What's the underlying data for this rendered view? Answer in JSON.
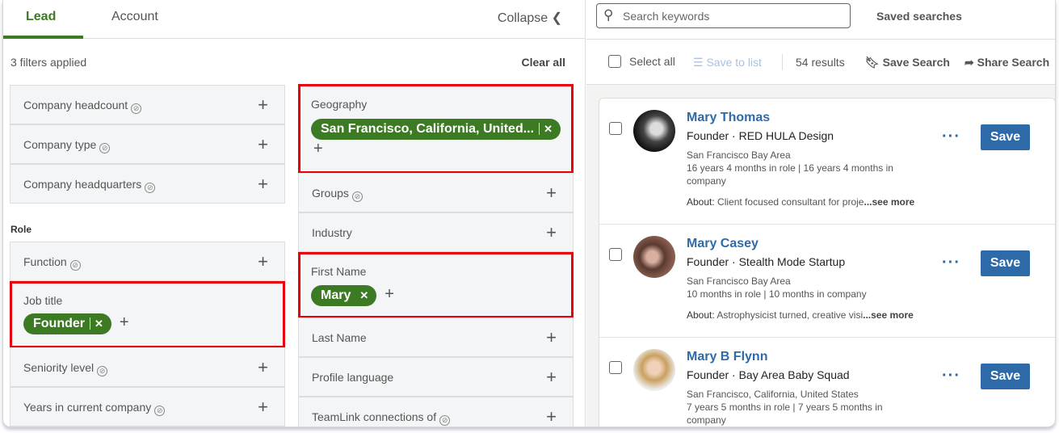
{
  "tabs": {
    "lead": "Lead",
    "account": "Account",
    "collapse": "Collapse ❮"
  },
  "filters_applied": "3 filters applied",
  "clear_all": "Clear all",
  "role_label": "Role",
  "left_filters": [
    "Company headcount",
    "Company type",
    "Company headquarters",
    "Function",
    "Job title",
    "Seniority level",
    "Years in current company"
  ],
  "job_title_value": "Founder",
  "right_filters": [
    "Geography",
    "Groups",
    "Industry",
    "First Name",
    "Last Name",
    "Profile language",
    "TeamLink connections of"
  ],
  "geography_value": "San Francisco, California, United...",
  "first_name_value": "Mary",
  "search": {
    "placeholder": "Search keywords",
    "saved": "Saved searches"
  },
  "toolbar": {
    "select_all": "Select all",
    "save_to_list": "Save to list",
    "results": "54 results",
    "save_search": "Save Search",
    "share_search": "Share Search"
  },
  "leads": [
    {
      "name": "Mary Thomas",
      "title": "Founder · RED HULA Design",
      "location": "San Francisco Bay Area",
      "tenure": "16 years 4 months in role | 16 years 4 months in company",
      "about_label": "About:",
      "about": "Client focused consultant for proje",
      "see_more": "...see more",
      "save": "Save"
    },
    {
      "name": "Mary Casey",
      "title": "Founder · Stealth Mode Startup",
      "location": "San Francisco Bay Area",
      "tenure": "10 months in role | 10 months in company",
      "about_label": "About:",
      "about": "Astrophysicist turned, creative visi",
      "see_more": "...see more",
      "save": "Save"
    },
    {
      "name": "Mary B Flynn",
      "title": "Founder · Bay Area Baby Squad",
      "location": "San Francisco, California, United States",
      "tenure": "7 years 5 months in role | 7 years 5 months in company",
      "save": "Save"
    }
  ],
  "colors": {
    "accent_green": "#3d7a24",
    "link_blue": "#2e6aa8",
    "highlight_red": "#e8000b"
  }
}
